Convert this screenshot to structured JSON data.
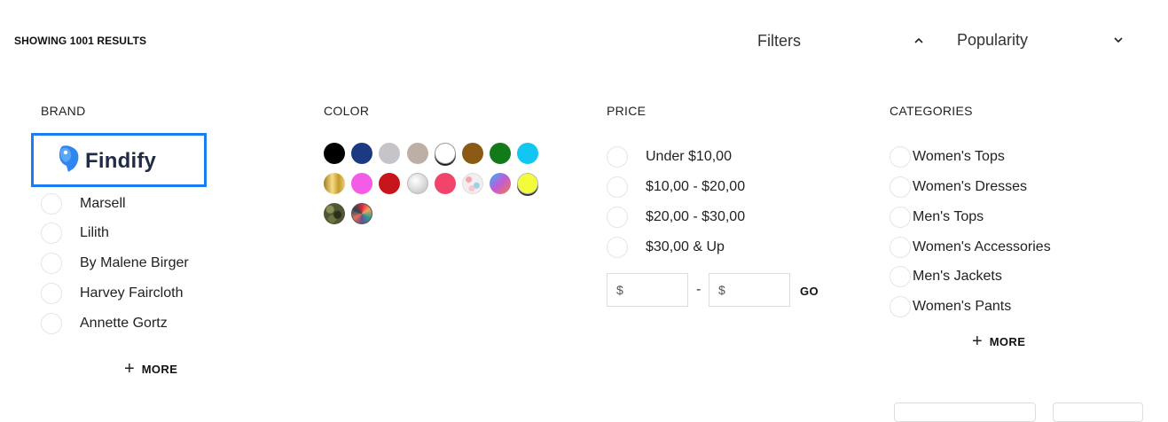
{
  "header": {
    "results_text": "SHOWING 1001 RESULTS",
    "filters_label": "Filters",
    "sort_label": "Popularity"
  },
  "brand": {
    "title": "BRAND",
    "logo_text": "Findify",
    "items": [
      {
        "label": "Marsell"
      },
      {
        "label": "Lilith"
      },
      {
        "label": "By Malene Birger"
      },
      {
        "label": "Harvey Faircloth"
      },
      {
        "label": "Annette Gortz"
      }
    ],
    "more_label": "MORE"
  },
  "color": {
    "title": "COLOR",
    "swatches": [
      {
        "name": "black",
        "color": "#000000"
      },
      {
        "name": "navy",
        "color": "#1b3a82"
      },
      {
        "name": "light-grey",
        "color": "#c7c4c9"
      },
      {
        "name": "taupe",
        "color": "#bdafa6"
      },
      {
        "name": "white",
        "color": "#ffffff"
      },
      {
        "name": "brown",
        "color": "#8a5a14"
      },
      {
        "name": "green",
        "color": "#137a19"
      },
      {
        "name": "cyan",
        "color": "#12c6f2"
      },
      {
        "name": "gold",
        "color": "#d4b14e"
      },
      {
        "name": "pink",
        "color": "#f25ce6"
      },
      {
        "name": "red",
        "color": "#c8151b"
      },
      {
        "name": "silver",
        "color": "#e2e2e2"
      },
      {
        "name": "coral",
        "color": "#f2446a"
      },
      {
        "name": "floral",
        "color": "#e8d6d8"
      },
      {
        "name": "gradient",
        "color": "#8a67c9"
      },
      {
        "name": "yellow",
        "color": "#f2fc3a"
      },
      {
        "name": "camouflage",
        "color": "#4f5734"
      },
      {
        "name": "multicolor",
        "color": "#b5483d"
      }
    ]
  },
  "price": {
    "title": "PRICE",
    "ranges": [
      {
        "label": "Under $10,00"
      },
      {
        "label": "$10,00 - $20,00"
      },
      {
        "label": "$20,00 - $30,00"
      },
      {
        "label": "$30,00 & Up"
      }
    ],
    "currency": "$",
    "dash": "-",
    "go_label": "GO"
  },
  "categories": {
    "title": "CATEGORIES",
    "items": [
      {
        "label": "Women's Tops"
      },
      {
        "label": "Women's Dresses"
      },
      {
        "label": "Men's Tops"
      },
      {
        "label": "Women's Accessories"
      },
      {
        "label": "Men's Jackets"
      },
      {
        "label": "Women's Pants"
      }
    ],
    "more_label": "MORE"
  }
}
